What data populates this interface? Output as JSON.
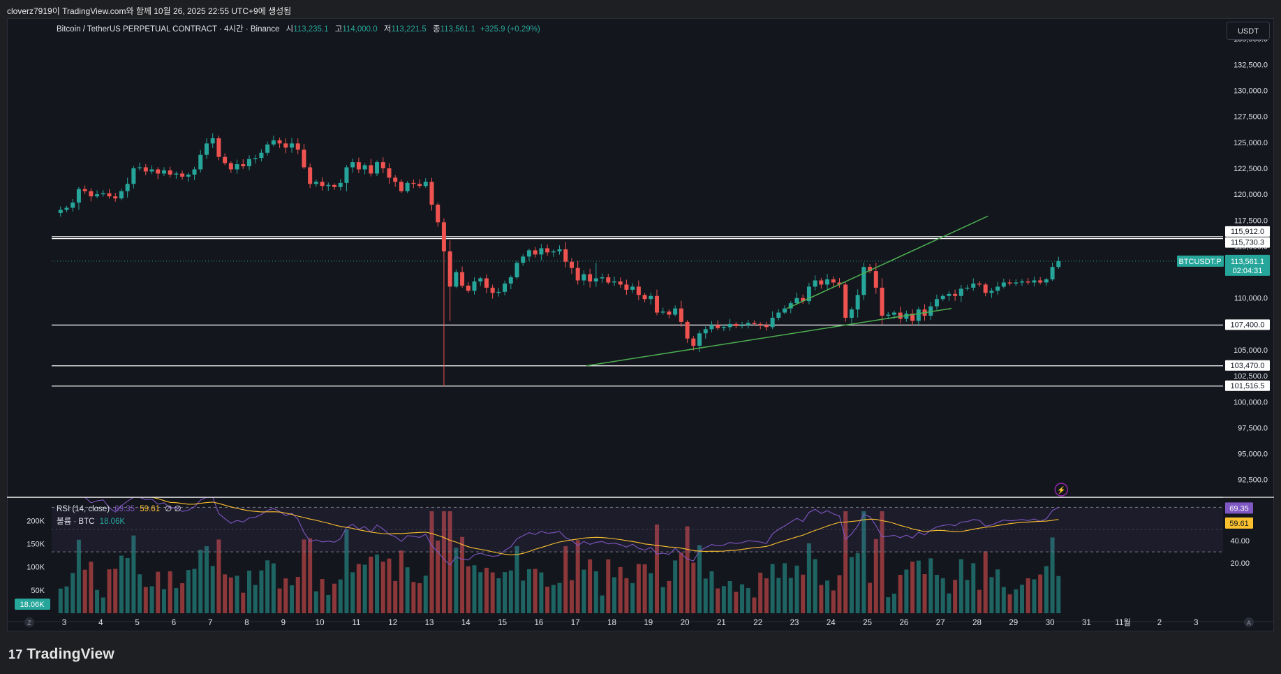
{
  "header": {
    "text": "cloverz7919이 TradingView.com와 함께 10월 26, 2025 22:55 UTC+9에 생성됨"
  },
  "legend": {
    "title": "Bitcoin / TetherUS PERPETUAL CONTRACT · 4시간 · Binance",
    "open_label": "시",
    "open": "113,235.1",
    "high_label": "고",
    "high": "114,000.0",
    "low_label": "저",
    "low": "113,221.5",
    "close_label": "종",
    "close": "113,561.1",
    "change": "+325.9 (+0.29%)"
  },
  "currency_button": "USDT",
  "rsi_legend": {
    "name": "RSI (14, close)",
    "rsi": "69.35",
    "ma": "59.61",
    "extra": "∅ ∅"
  },
  "vol_legend": {
    "name": "볼륨 · BTC",
    "value": "18.06K"
  },
  "symbol_tag": "BTCUSDT.P",
  "last_price": {
    "price": "113,561.1",
    "countdown": "02:04:31"
  },
  "rsi_tags": {
    "rsi": "69.35",
    "ma": "59.61"
  },
  "footer": {
    "logo": "17",
    "brand": "TradingView"
  },
  "corner_labels": {
    "left": "Z",
    "right": "A"
  },
  "colors": {
    "up": "#26a69a",
    "down": "#ef5350",
    "background": "#14161d",
    "rsi": "#7e57c2",
    "rsi_ma": "#fbc02d",
    "trendline": "#4caf50",
    "level": "#ffffff"
  },
  "chart_data": {
    "type": "candlestick",
    "interval": "4h",
    "x_ticks": [
      "3",
      "4",
      "5",
      "6",
      "7",
      "8",
      "9",
      "10",
      "11",
      "12",
      "13",
      "14",
      "15",
      "16",
      "17",
      "18",
      "19",
      "20",
      "21",
      "22",
      "23",
      "24",
      "25",
      "26",
      "27",
      "28",
      "29",
      "30",
      "31",
      "11월",
      "2",
      "3"
    ],
    "y_ticks": [
      "135,000.0",
      "132,500.0",
      "130,000.0",
      "127,500.0",
      "125,000.0",
      "122,500.0",
      "120,000.0",
      "117,500.0",
      "115,000.0",
      "112,500.0",
      "110,000.0",
      "107,500.0",
      "105,000.0",
      "102,500.0",
      "100,000.0",
      "97,500.0",
      "95,000.0",
      "92,500.0"
    ],
    "ylim": [
      90800,
      136300
    ],
    "horizontal_levels": [
      {
        "value": 115912.0,
        "label": "115,912.0"
      },
      {
        "value": 115730.3,
        "label": "115,730.3"
      },
      {
        "value": 107400.0,
        "label": "107,400.0"
      },
      {
        "value": 103470.0,
        "label": "103,470.0"
      },
      {
        "value": 101516.5,
        "label": "101,516.5"
      }
    ],
    "current_price": 113561.1,
    "day_starts": [
      3,
      4,
      5,
      6,
      7,
      8,
      9,
      10,
      11,
      12,
      13,
      14,
      15,
      16,
      17,
      18,
      19,
      20,
      21,
      22,
      23,
      24,
      25,
      26,
      27,
      28,
      29,
      30,
      31,
      32,
      33,
      34
    ],
    "candles_start_day": 2.9,
    "candles_per_day": 6,
    "closes": [
      118500,
      118700,
      119200,
      120500,
      120300,
      119800,
      120000,
      120100,
      119800,
      119600,
      120300,
      121000,
      122500,
      122600,
      122200,
      122400,
      122000,
      122300,
      121900,
      122000,
      121700,
      121900,
      122400,
      123800,
      124900,
      125400,
      123600,
      123000,
      122400,
      122900,
      122700,
      123400,
      123500,
      124000,
      124800,
      125200,
      124900,
      124500,
      124900,
      124300,
      122600,
      121000,
      121200,
      120800,
      120900,
      120700,
      121100,
      122600,
      123100,
      122400,
      122800,
      122000,
      123100,
      122500,
      121600,
      121200,
      120300,
      121100,
      121000,
      120800,
      121200,
      119000,
      117300,
      114500,
      111100,
      112500,
      111200,
      110700,
      111600,
      111900,
      111000,
      110500,
      110600,
      111400,
      112000,
      113400,
      114000,
      114600,
      114200,
      114800,
      114400,
      114500,
      114700,
      113500,
      112900,
      111700,
      112300,
      111600,
      111900,
      112000,
      111500,
      111600,
      111300,
      110800,
      111100,
      110300,
      109900,
      110200,
      108600,
      108700,
      108400,
      109000,
      107700,
      106100,
      105400,
      106600,
      107000,
      107400,
      107100,
      107200,
      107500,
      107300,
      107400,
      107600,
      107500,
      107400,
      107200,
      108100,
      108600,
      109000,
      109500,
      110000,
      109700,
      111100,
      111700,
      111300,
      111800,
      111500,
      111300,
      108100,
      108900,
      110300,
      113000,
      112600,
      111000,
      108300,
      108400,
      108600,
      108000,
      108500,
      107800,
      108900,
      108300,
      109200,
      109900,
      110200,
      110400,
      110200,
      110900,
      111000,
      111400,
      111300,
      110500,
      110700,
      111100,
      111500,
      111400,
      111500,
      111600,
      111500,
      111700,
      111500,
      111800,
      113000,
      113561
    ],
    "volume": {
      "unit": "BTC",
      "last": 18060,
      "y_ticks": [
        "200K",
        "150K",
        "100K",
        "50K"
      ]
    },
    "rsi": {
      "period": 14,
      "last": 69.35,
      "ma_last": 59.61,
      "ylim": [
        10,
        79
      ],
      "bands": [
        70,
        30
      ],
      "y_ticks": [
        "40.00",
        "20.00"
      ]
    },
    "trendlines": [
      {
        "from": {
          "day": 17.3,
          "value": 103470
        },
        "to": {
          "day": 27.3,
          "value": 109000
        }
      },
      {
        "from": {
          "day": 22.8,
          "value": 109000
        },
        "to": {
          "day": 28.3,
          "value": 117900
        }
      }
    ]
  }
}
